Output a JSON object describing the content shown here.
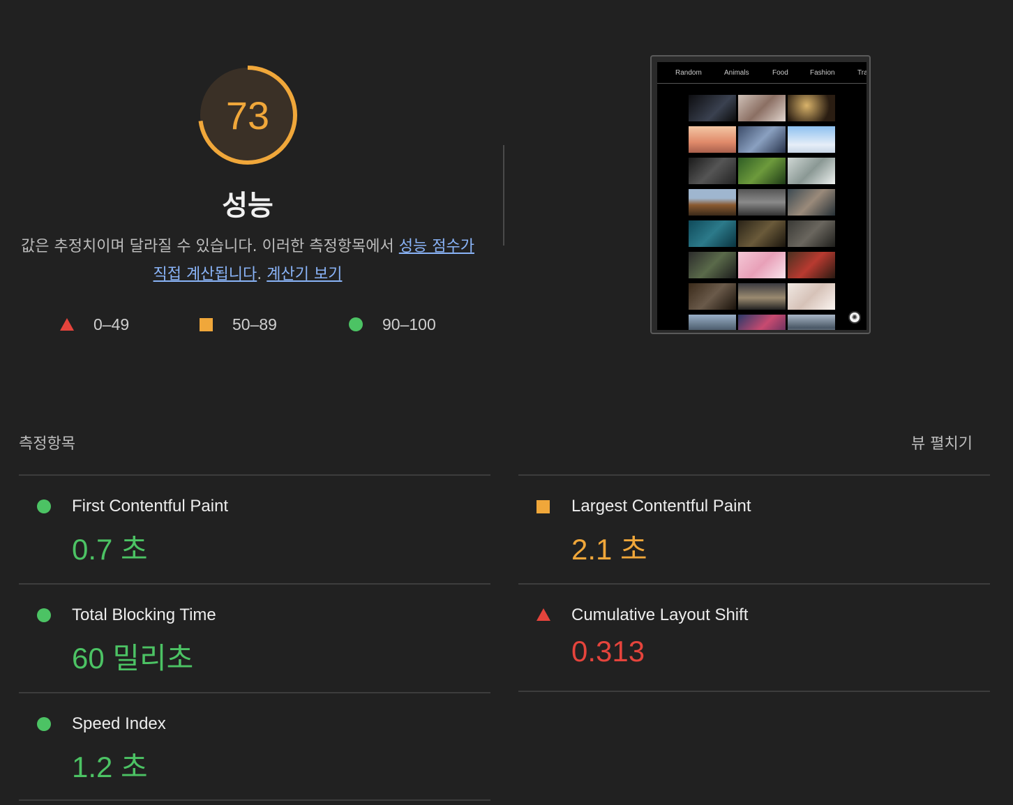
{
  "score": {
    "value": "73",
    "fraction": 0.73,
    "color": "#f0a73a"
  },
  "category": {
    "title": "성능",
    "desc_prefix": "값은 추정치이며 달라질 수 있습니다. 이러한 측정항목에서 ",
    "desc_link1": "성능 점수가 직접 계산됩니다",
    "desc_mid": ". ",
    "desc_link2": "계산기 보기"
  },
  "legend": [
    {
      "range": "0–49",
      "icon": "triangle-fail-icon",
      "color": "#e5443c"
    },
    {
      "range": "50–89",
      "icon": "square-average-icon",
      "color": "#f0a73a"
    },
    {
      "range": "90–100",
      "icon": "circle-pass-icon",
      "color": "#4cc364"
    }
  ],
  "screenshot": {
    "nav": [
      "Random",
      "Animals",
      "Food",
      "Fashion",
      "Tra"
    ]
  },
  "metrics_section": {
    "title": "측정항목",
    "expand_label": "뷰 펼치기"
  },
  "metrics": [
    {
      "name": "First Contentful Paint",
      "value": "0.7 초",
      "status": "pass"
    },
    {
      "name": "Largest Contentful Paint",
      "value": "2.1 초",
      "status": "average"
    },
    {
      "name": "Total Blocking Time",
      "value": "60 밀리초",
      "status": "pass"
    },
    {
      "name": "Cumulative Layout Shift",
      "value": "0.313",
      "status": "fail"
    },
    {
      "name": "Speed Index",
      "value": "1.2 초",
      "status": "pass"
    }
  ]
}
